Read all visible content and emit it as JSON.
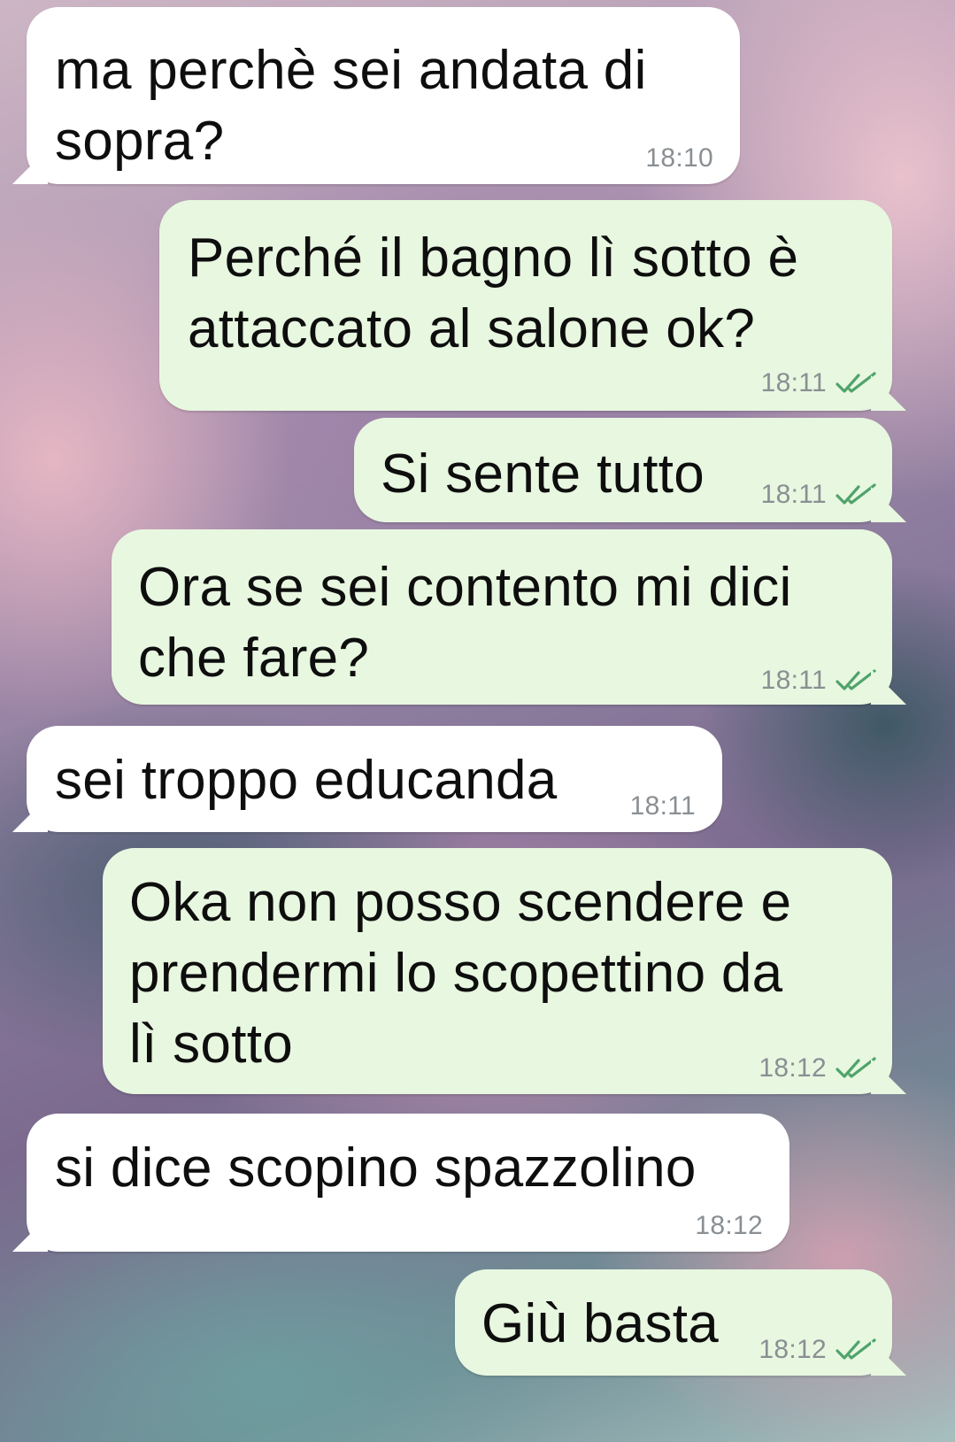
{
  "messages": [
    {
      "text": "ma perchè sei andata di\nsopra?",
      "line1": "ma perchè sei andata di",
      "line2": "sopra?",
      "time": "18:10",
      "direction": "incoming"
    },
    {
      "line1": "Perché il bagno lì sotto è",
      "line2": "attaccato al salone ok?",
      "time": "18:11",
      "direction": "outgoing",
      "status": "read"
    },
    {
      "line1": "Si sente tutto",
      "time": "18:11",
      "direction": "outgoing",
      "status": "read"
    },
    {
      "line1": "Ora se sei contento mi dici",
      "line2": "che fare?",
      "time": "18:11",
      "direction": "outgoing",
      "status": "read"
    },
    {
      "line1": "sei troppo educanda",
      "time": "18:11",
      "direction": "incoming"
    },
    {
      "line1": "Oka non posso scendere e",
      "line2": "prendermi lo scopettino da",
      "line3": "lì sotto",
      "time": "18:12",
      "direction": "outgoing",
      "status": "read"
    },
    {
      "line1": "si dice scopino spazzolino",
      "time": "18:12",
      "direction": "incoming"
    },
    {
      "line1": "Giù basta",
      "time": "18:12",
      "direction": "outgoing",
      "status": "read"
    }
  ],
  "colors": {
    "incoming_bubble": "#ffffff",
    "outgoing_bubble": "#e8f7e0",
    "read_tick": "#4fa36a",
    "timestamp": "#8a8f93"
  },
  "icons": {
    "read_receipt": "double-check-icon"
  }
}
